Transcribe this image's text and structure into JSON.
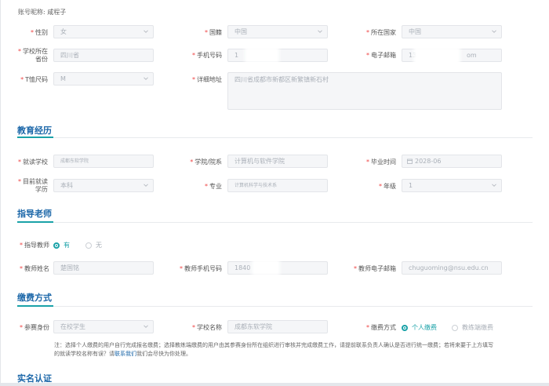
{
  "account": {
    "label": "账号昵称:",
    "value": "咸程子"
  },
  "basic": {
    "gender": {
      "label": "性别",
      "value": "女"
    },
    "ethnicity": {
      "label": "国籍",
      "value": "中国"
    },
    "country": {
      "label": "所在国家",
      "value": "中国"
    },
    "school_prov": {
      "label_l1": "学校所在",
      "label_l2": "省份",
      "value": "四川省"
    },
    "phone": {
      "label": "手机号码",
      "value": "1"
    },
    "email": {
      "label": "电子邮箱",
      "value_a": "13",
      "value_b": "om"
    },
    "tshirt": {
      "label": "T恤尺码",
      "value": "M"
    },
    "address": {
      "label": "详细地址",
      "value": "四川省成都市新都区新繁镇新石村"
    }
  },
  "education": {
    "title": "教育经历",
    "school": {
      "label": "就读学校",
      "value": "成都东软学院"
    },
    "college": {
      "label": "学院/院系",
      "value": "计算机与软件学院"
    },
    "grad_time": {
      "label": "毕业时间",
      "value": "2028-06"
    },
    "degree": {
      "label_l1": "目前就读",
      "label_l2": "学历",
      "value": "本科"
    },
    "major": {
      "label": "专业",
      "value": "计算机科学与技术系"
    },
    "grade": {
      "label": "年级",
      "value": "1"
    }
  },
  "teacher": {
    "title": "指导老师",
    "has_label": "指导教师",
    "opt_yes": "有",
    "opt_no": "无",
    "name": {
      "label": "教师姓名",
      "value": "楚国铭"
    },
    "phone": {
      "label": "教师手机号码",
      "value": "1840"
    },
    "email": {
      "label": "教师电子邮箱",
      "value": "chuguoming@nsu.edu.cn"
    }
  },
  "payment": {
    "title": "缴费方式",
    "identity": {
      "label": "参赛身份",
      "value": "在校学生"
    },
    "school": {
      "label": "学校名称",
      "value": "成都东软学院"
    },
    "method_label": "缴费方式",
    "opt_personal": "个人缴费",
    "opt_coach": "教练端缴费",
    "note_line1": "注：选择个人缴费的用户自行完成报名缴费；选择教练端缴费的用户由其参赛身份所在组织进行审核并完成缴费工作，请提前联系负责人确认是否进行统一缴费；若将来要于上方填写",
    "note_line2_a": "的就读学校名称有误？请",
    "note_link": "联系我们",
    "note_line2_b": "我们会尽快为你处理。"
  },
  "realname": {
    "title": "实名认证"
  },
  "colors": {
    "accent": "#1aa2a8",
    "section_title": "#1a66a8",
    "required": "#e44444"
  }
}
